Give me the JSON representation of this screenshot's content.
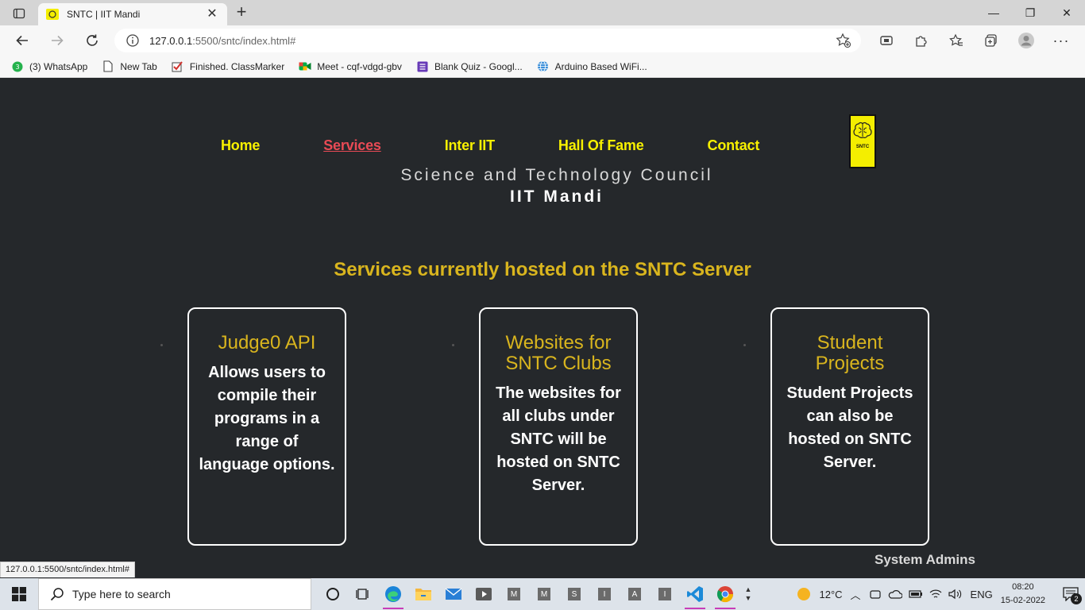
{
  "browser": {
    "tab_title": "SNTC | IIT Mandi",
    "url_host": "127.0.0.1",
    "url_rest": ":5500/sntc/index.html#",
    "bookmarks": [
      {
        "label": "(3) WhatsApp",
        "icon": "whatsapp-icon"
      },
      {
        "label": "New Tab",
        "icon": "page-icon"
      },
      {
        "label": "Finished. ClassMarker",
        "icon": "checkmark-icon"
      },
      {
        "label": "Meet - cqf-vdgd-gbv",
        "icon": "meet-icon"
      },
      {
        "label": "Blank Quiz - Googl...",
        "icon": "forms-icon"
      },
      {
        "label": "Arduino Based WiFi...",
        "icon": "globe-icon"
      }
    ],
    "status_url": "127.0.0.1:5500/sntc/index.html#"
  },
  "site": {
    "nav": [
      {
        "label": "Home",
        "active": false
      },
      {
        "label": "Services",
        "active": true
      },
      {
        "label": "Inter IIT",
        "active": false
      },
      {
        "label": "Hall Of Fame",
        "active": false
      },
      {
        "label": "Contact",
        "active": false
      }
    ],
    "logo_text": "SNTC",
    "council_line1": "Science and Technology Council",
    "council_line2": "IIT Mandi",
    "services_heading": "Services currently hosted on the SNTC Server",
    "cards": [
      {
        "title": "Judge0 API",
        "body": "Allows users to compile their programs in a range of language options."
      },
      {
        "title": "Websites for SNTC Clubs",
        "body": "The websites for all clubs under SNTC will be hosted on SNTC Server."
      },
      {
        "title": "Student Projects",
        "body": "Student Projects can also be hosted on SNTC Server."
      }
    ],
    "system_admins": "System Admins",
    "colors": {
      "nav": "#f7f000",
      "active_nav": "#e94a55",
      "heading": "#d9b51e",
      "background": "#25282b"
    }
  },
  "taskbar": {
    "search_placeholder": "Type here to search",
    "temperature": "12°C",
    "language": "ENG",
    "time": "08:20",
    "date": "15-02-2022",
    "notifications": "2",
    "letter_apps": [
      "M",
      "M",
      "S",
      "I",
      "A",
      "I"
    ]
  }
}
